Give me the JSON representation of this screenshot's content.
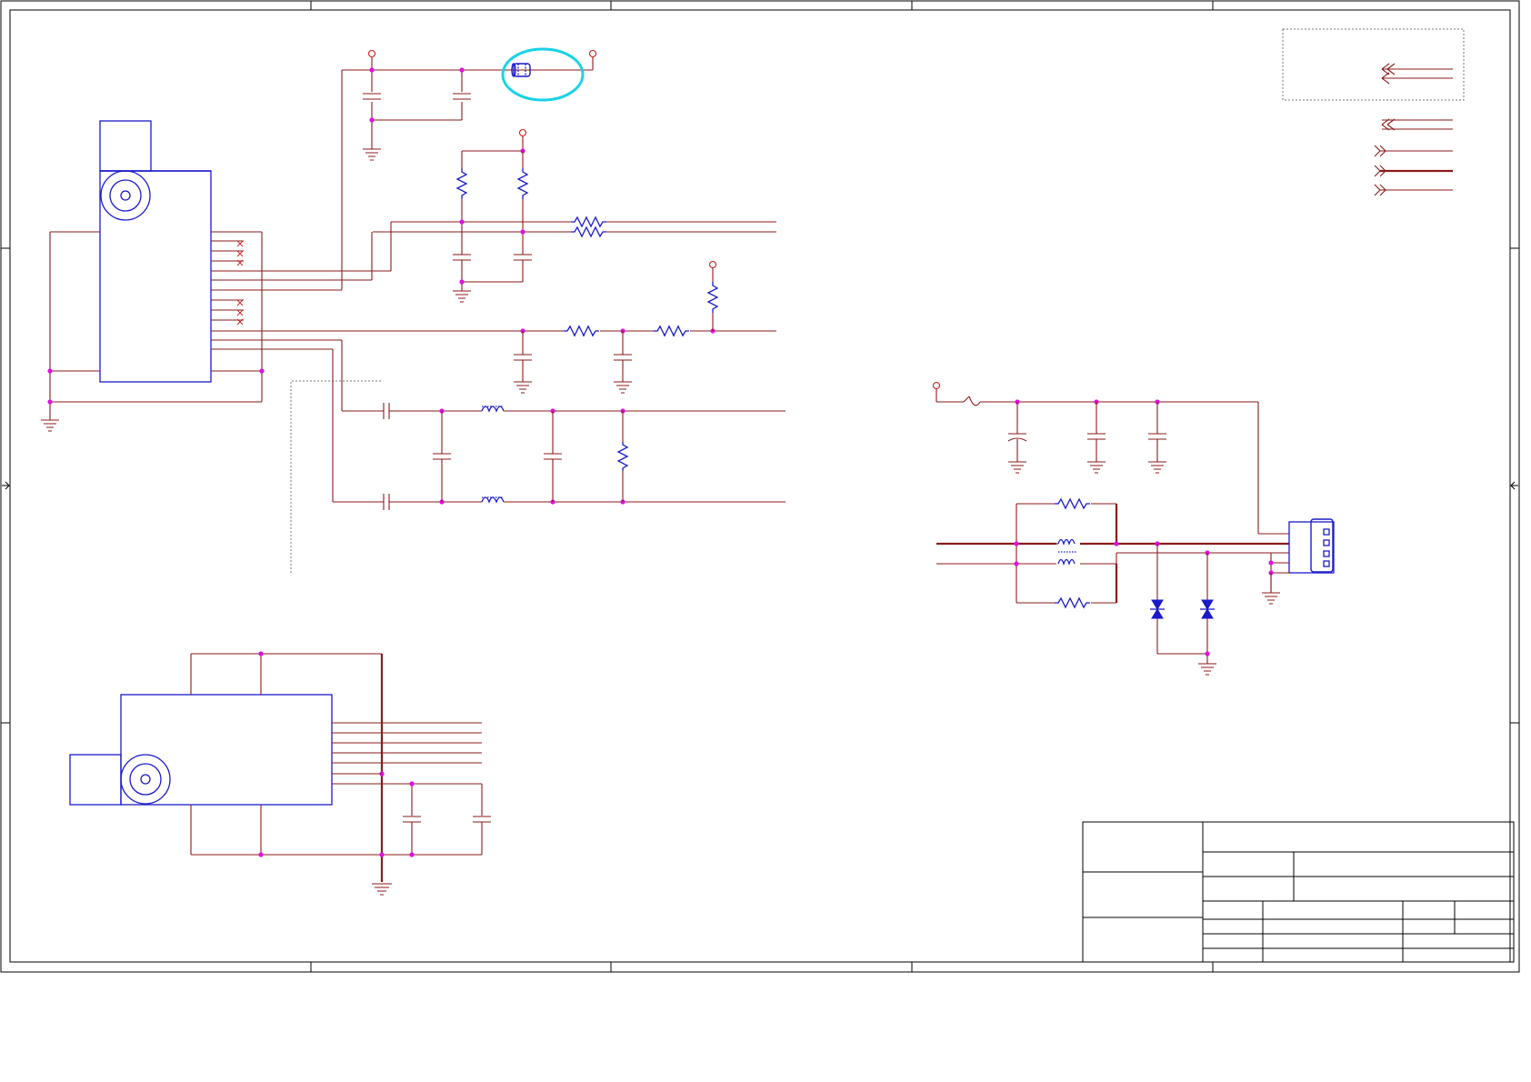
{
  "document": {
    "kind": "schematic-sheet",
    "visible_text": []
  },
  "colors": {
    "wire": "#8b1a1a",
    "part": "#1a1acc",
    "junction": "#e010e0",
    "power_flag": "#cc1a1a",
    "highlight": "#19d3e6",
    "frame": "#000000"
  },
  "icons": {
    "ground": "ground-symbol-icon",
    "power": "power-flag-icon",
    "resistor": "resistor-icon",
    "capacitor": "capacitor-icon",
    "inductor": "inductor-icon",
    "tvs": "tvs-diode-icon",
    "usb": "usb-connector-icon",
    "fuse": "fuse-icon",
    "ferrite": "ferrite-bead-icon",
    "port_in": "port-in-icon",
    "port_out": "port-out-icon"
  }
}
